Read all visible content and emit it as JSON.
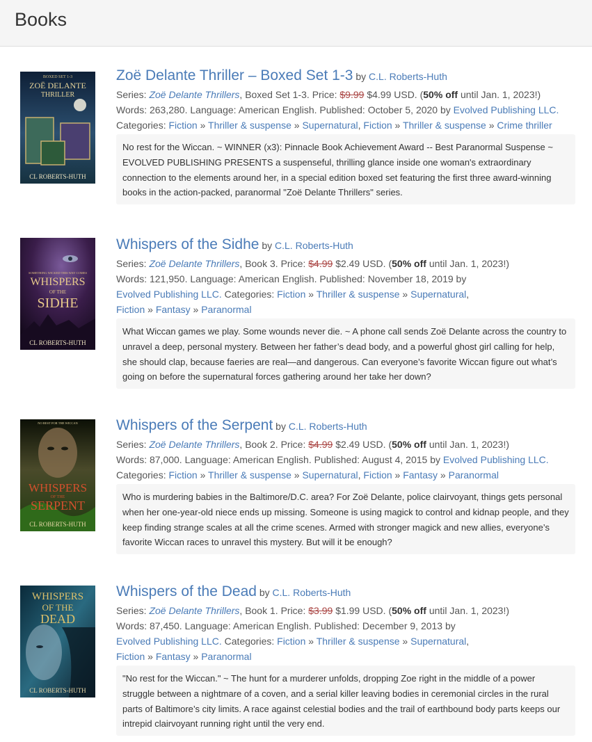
{
  "page": {
    "title": "Books"
  },
  "labels": {
    "by": "by",
    "series": "Series:",
    "price": "Price:",
    "off": "off",
    "until_prefix": "until",
    "words": "Words:",
    "language": "Language:",
    "published": "Published:",
    "published_by": "by",
    "categories": "Categories:",
    "sep": "»",
    "comma": ","
  },
  "books": [
    {
      "title": "Zoë Delante Thriller – Boxed Set 1-3",
      "author": "C.L. Roberts-Huth",
      "series": "Zoë Delante Thrillers",
      "series_pos": "Boxed Set 1-3.",
      "old_price": "$9.99",
      "new_price": "$4.99 USD.",
      "discount": "50%",
      "until": "Jan. 1, 2023!",
      "words": "263,280.",
      "language": "American English.",
      "published": "October 5, 2020",
      "publisher": "Evolved Publishing LLC.",
      "categories": [
        "Fiction",
        "Thriller & suspense",
        "Supernatural",
        "Fiction",
        "Thriller & suspense",
        "Crime thriller"
      ],
      "description": "No rest for the Wiccan. ~ WINNER (x3): Pinnacle Book Achievement Award -- Best Paranormal Suspense ~ EVOLVED PUBLISHING PRESENTS a suspenseful, thrilling glance inside one woman's extraordinary connection to the elements around her, in a special edition boxed set featuring the first three award-winning books in the action-packed, paranormal \"Zoë Delante Thrillers\" series.",
      "cover": {
        "top": "BOXED SET 1-3",
        "line1": "ZOË DELANTE",
        "line2": "THRILLER",
        "author": "CL ROBERTS-HUTH",
        "bg": "#1c3a5e",
        "accent": "#d8c38a"
      }
    },
    {
      "title": "Whispers of the Sidhe",
      "author": "C.L. Roberts-Huth",
      "series": "Zoë Delante Thrillers",
      "series_pos": "Book 3.",
      "old_price": "$4.99",
      "new_price": "$2.49 USD.",
      "discount": "50%",
      "until": "Jan. 1, 2023!)",
      "words": "121,950.",
      "language": "American English.",
      "published": "November 18, 2019",
      "publisher": "Evolved Publishing LLC.",
      "categories": [
        "Fiction",
        "Thriller & suspense",
        "Supernatural",
        "Fiction",
        "Fantasy",
        "Paranormal"
      ],
      "description": "What Wiccan games we play. Some wounds never die. ~ A phone call sends Zoë Delante across the country to unravel a deep, personal mystery. Between her father’s dead body, and a powerful ghost girl calling for help, she should clap, because faeries are real—and dangerous. Can everyone’s favorite Wiccan figure out what’s going on before the supernatural forces gathering around her take her down?",
      "cover": {
        "top": "SOMETHING WICKED THIS WAY COMES",
        "line1": "WHISPERS",
        "line2": "OF THE",
        "line3": "SIDHE",
        "author": "CL ROBERTS-HUTH",
        "bg": "#3a1d4a",
        "accent": "#e0c080"
      }
    },
    {
      "title": "Whispers of the Serpent",
      "author": "C.L. Roberts-Huth",
      "series": "Zoë Delante Thrillers",
      "series_pos": "Book 2.",
      "old_price": "$4.99",
      "new_price": "$2.49 USD.",
      "discount": "50%",
      "until": "Jan. 1, 2023!)",
      "words": "87,000.",
      "language": "American English.",
      "published": "August 4, 2015",
      "publisher": "Evolved Publishing LLC.",
      "categories": [
        "Fiction",
        "Thriller & suspense",
        "Supernatural",
        "Fiction",
        "Fantasy",
        "Paranormal"
      ],
      "description": "Who is murdering babies in the Baltimore/D.C. area? For Zoë Delante, police clairvoyant, things gets personal when her one-year-old niece ends up missing. Someone is using magick to control and kidnap people, and they keep finding strange scales at all the crime scenes. Armed with stronger magick and new allies, everyone’s favorite Wiccan races to unravel this mystery. But will it be enough?",
      "cover": {
        "top": "NO REST FOR THE WICCAN",
        "line1": "WHISPERS",
        "line2": "OF THE",
        "line3": "SERPENT",
        "author": "CL ROBERTS-HUTH",
        "bg": "#1f2a12",
        "accent": "#c44a2a"
      }
    },
    {
      "title": "Whispers of the Dead",
      "author": "C.L. Roberts-Huth",
      "series": "Zoë Delante Thrillers",
      "series_pos": "Book 1.",
      "old_price": "$3.99",
      "new_price": "$1.99 USD.",
      "discount": "50%",
      "until": "Jan. 1, 2023!)",
      "words": "87,450.",
      "language": "American English.",
      "published": "December 9, 2013",
      "publisher": "Evolved Publishing LLC.",
      "categories": [
        "Fiction",
        "Thriller & suspense",
        "Supernatural",
        "Fiction",
        "Fantasy",
        "Paranormal"
      ],
      "description": "\"No rest for the Wiccan.\" ~ The hunt for a murderer unfolds, dropping Zoe right in the middle of a power struggle between a nightmare of a coven, and a serial killer leaving bodies in ceremonial circles in the rural parts of Baltimore’s city limits. A race against celestial bodies and the trail of earthbound body parts keeps our intrepid clairvoyant running right until the very end.",
      "cover": {
        "line1": "WHISPERS",
        "line2": "OF THE",
        "line3": "DEAD",
        "author": "CL ROBERTS-HUTH",
        "bg": "#123a4a",
        "accent": "#d8c06a"
      }
    }
  ]
}
